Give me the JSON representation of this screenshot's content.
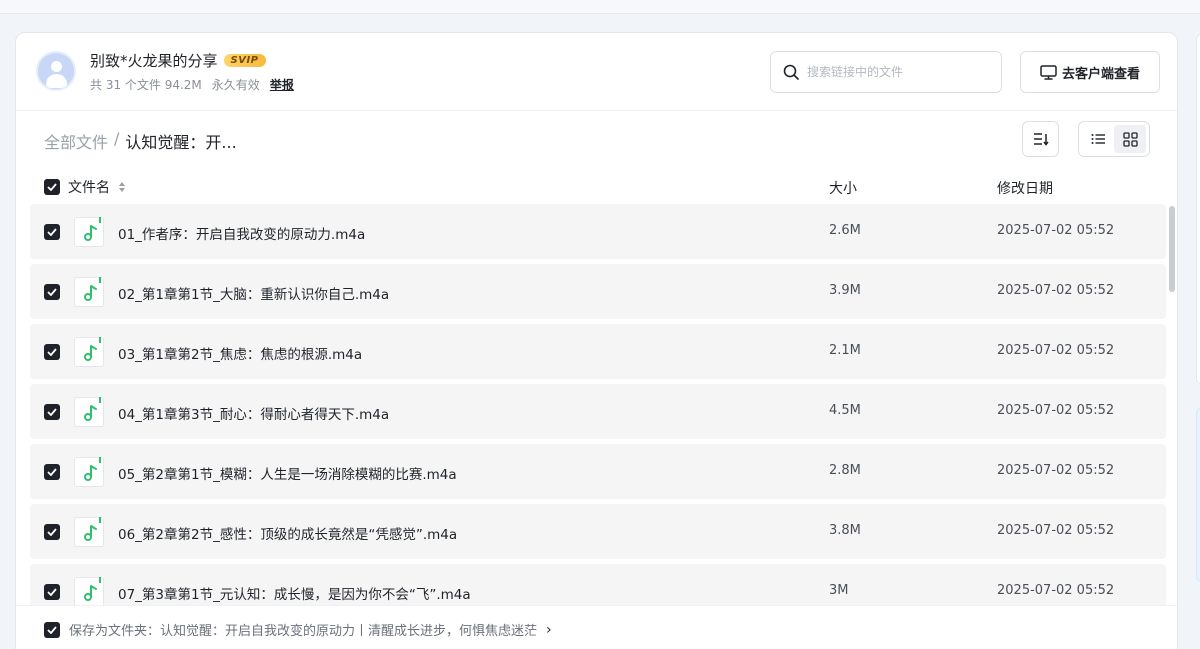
{
  "share": {
    "owner_name": "别致*火龙果的分享",
    "vip_badge": "SVIP",
    "file_count": "共 31 个文件 94.2M",
    "validity": "永久有效",
    "report": "举报"
  },
  "search": {
    "placeholder": "搜索链接中的文件"
  },
  "client_button": {
    "label": "去客户端查看"
  },
  "breadcrumb": {
    "root": "全部文件",
    "separator": "/",
    "current": "认知觉醒：开..."
  },
  "table": {
    "columns": {
      "name": "文件名",
      "size": "大小",
      "date": "修改日期"
    },
    "rows": [
      {
        "name": "01_作者序：开启自我改变的原动力.m4a",
        "size": "2.6M",
        "date": "2025-07-02 05:52"
      },
      {
        "name": "02_第1章第1节_大脑：重新认识你自己.m4a",
        "size": "3.9M",
        "date": "2025-07-02 05:52"
      },
      {
        "name": "03_第1章第2节_焦虑：焦虑的根源.m4a",
        "size": "2.1M",
        "date": "2025-07-02 05:52"
      },
      {
        "name": "04_第1章第3节_耐心：得耐心者得天下.m4a",
        "size": "4.5M",
        "date": "2025-07-02 05:52"
      },
      {
        "name": "05_第2章第1节_模糊：人生是一场消除模糊的比赛.m4a",
        "size": "2.8M",
        "date": "2025-07-02 05:52"
      },
      {
        "name": "06_第2章第2节_感性：顶级的成长竟然是“凭感觉”.m4a",
        "size": "3.8M",
        "date": "2025-07-02 05:52"
      },
      {
        "name": "07_第3章第1节_元认知：成长慢，是因为你不会“飞”.m4a",
        "size": "3M",
        "date": "2025-07-02 05:52"
      }
    ]
  },
  "footer": {
    "save_to_label": "保存为文件夹：认知觉醒：开启自我改变的原动力丨清醒成长进步，何惧焦虑迷茫",
    "chevron": "›"
  },
  "colors": {
    "accent_dark": "#1f2329",
    "audio_icon": "#2fbf71",
    "row_bg": "#f5f5f6",
    "vip_gold": "#f6b93b"
  }
}
